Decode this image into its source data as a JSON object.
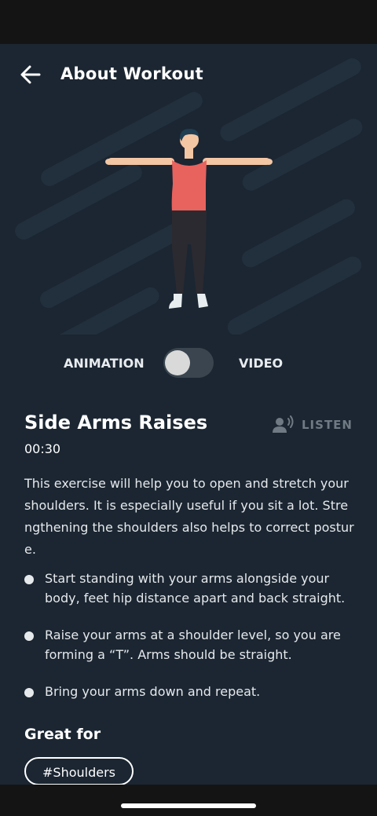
{
  "header": {
    "title": "About Workout",
    "back_icon": "arrow-left-icon"
  },
  "media_toggle": {
    "left_label": "ANIMATION",
    "right_label": "VIDEO",
    "selected": "ANIMATION"
  },
  "exercise": {
    "name": "Side Arms Raises",
    "duration": "00:30",
    "listen_label": "LISTEN",
    "listen_icon": "speaking-person-icon",
    "description": "This exercise will help you to open and stretch your shoulders. It is especially useful if you sit a lot. Strengthening the shoulders also helps to correct posture.",
    "steps": [
      "Start standing with your arms alongside your body, feet hip distance apart and back straight.",
      "Raise your arms at a shoulder level, so you are forming a “T”. Arms should be straight.",
      "Bring your arms down and repeat."
    ]
  },
  "great_for": {
    "heading": "Great for",
    "tags": [
      "#Shoulders"
    ]
  },
  "colors": {
    "background": "#1b2632",
    "system_bars": "#141414",
    "muted_text": "#6f7a84",
    "figure_top": "#e8625e",
    "figure_pants": "#2b2a30",
    "skin": "#f3c6a4"
  }
}
